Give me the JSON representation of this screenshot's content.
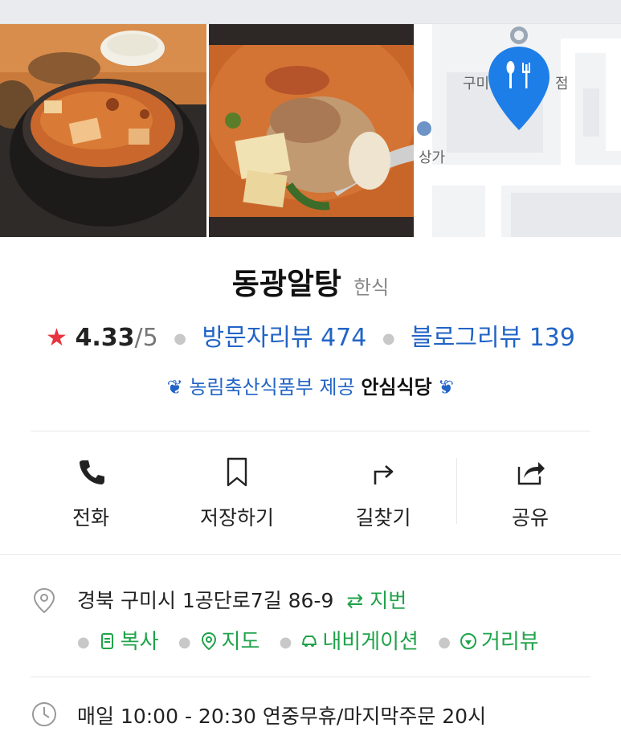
{
  "place": {
    "name": "동광알탕",
    "category": "한식"
  },
  "stats": {
    "rating": "4.33",
    "rating_max": "/5",
    "visitor_reviews": "방문자리뷰 474",
    "blog_reviews": "블로그리뷰 139"
  },
  "certification": {
    "provider": "농림축산식품부 제공",
    "badge": "안심식당"
  },
  "map": {
    "label_top": "구미",
    "label_top_right": "점",
    "label_left": "상가"
  },
  "actions": [
    {
      "label": "전화",
      "icon": "phone-icon"
    },
    {
      "label": "저장하기",
      "icon": "bookmark-icon"
    },
    {
      "label": "길찾기",
      "icon": "directions-icon"
    },
    {
      "label": "공유",
      "icon": "share-icon"
    }
  ],
  "address": {
    "text": "경북 구미시 1공단로7길 86-9",
    "lot_toggle": "⇄ 지번",
    "links": {
      "copy": "복사",
      "map": "지도",
      "navigation": "내비게이션",
      "street_view": "거리뷰"
    }
  },
  "hours": {
    "text": "매일 10:00 - 20:30 연중무휴/마지막주문 20시"
  },
  "colors": {
    "accent_blue": "#2264c6",
    "link_green": "#1fa34a",
    "star_red": "#e8343e",
    "map_pin": "#1e7ee8"
  }
}
